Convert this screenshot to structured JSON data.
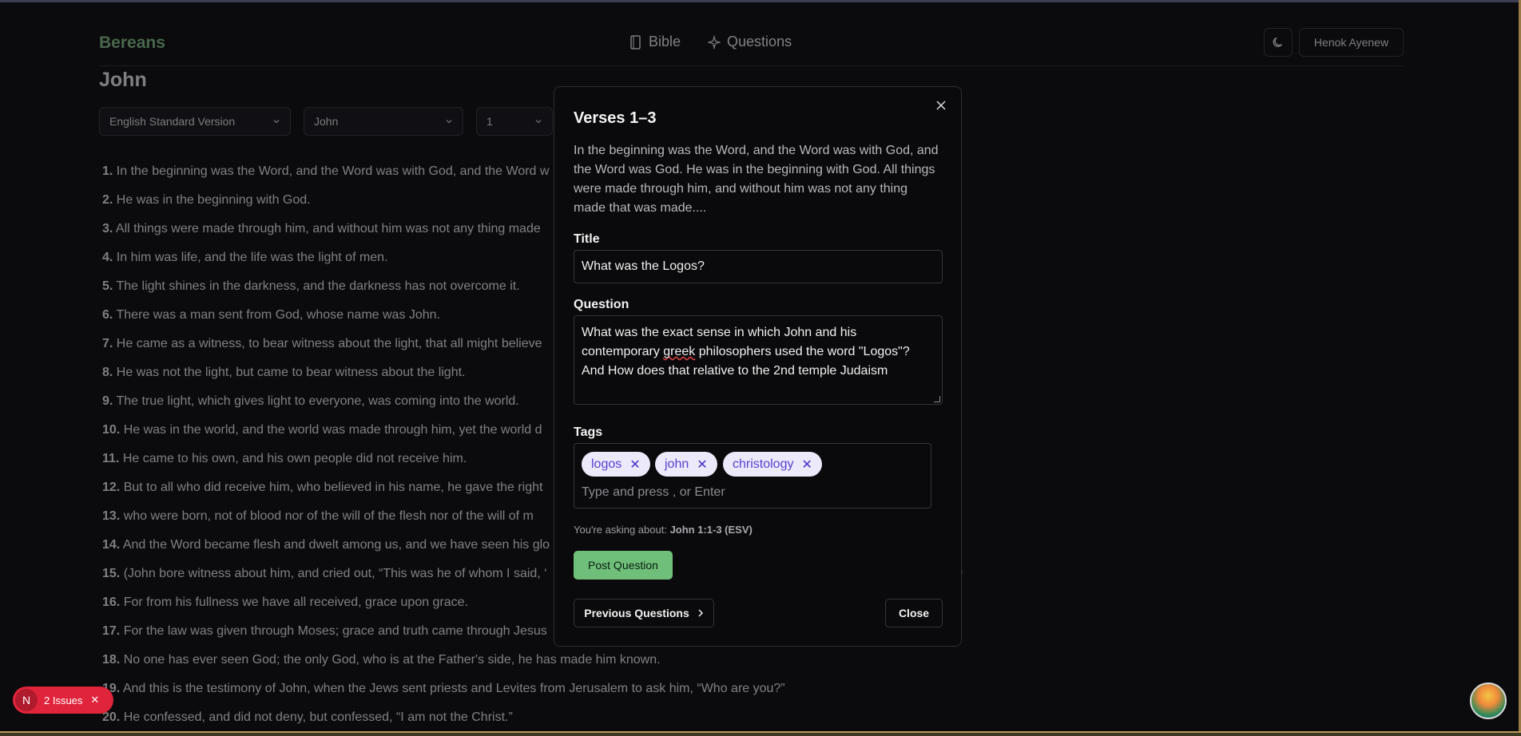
{
  "header": {
    "brand": "Bereans",
    "nav": [
      {
        "label": "Bible",
        "icon": "book-icon"
      },
      {
        "label": "Questions",
        "icon": "sparkle-icon"
      }
    ],
    "theme_icon": "moon-icon",
    "user_name": "Henok Ayenew"
  },
  "page": {
    "title": "John",
    "selects": {
      "version": "English Standard Version",
      "book": "John",
      "chapter": "1"
    },
    "verses": [
      {
        "num": "1.",
        "text": "In the beginning was the Word, and the Word was with God, and the Word w"
      },
      {
        "num": "2.",
        "text": "He was in the beginning with God."
      },
      {
        "num": "3.",
        "text": "All things were made through him, and without him was not any thing made"
      },
      {
        "num": "4.",
        "text": "In him was life, and the life was the light of men."
      },
      {
        "num": "5.",
        "text": "The light shines in the darkness, and the darkness has not overcome it."
      },
      {
        "num": "6.",
        "text": "There was a man sent from God, whose name was John."
      },
      {
        "num": "7.",
        "text": "He came as a witness, to bear witness about the light, that all might believe"
      },
      {
        "num": "8.",
        "text": "He was not the light, but came to bear witness about the light."
      },
      {
        "num": "9.",
        "text": "The true light, which gives light to everyone, was coming into the world."
      },
      {
        "num": "10.",
        "text": "He was in the world, and the world was made through him, yet the world d"
      },
      {
        "num": "11.",
        "text": "He came to his own, and his own people did not receive him."
      },
      {
        "num": "12.",
        "text": "But to all who did receive him, who believed in his name, he gave the right"
      },
      {
        "num": "13.",
        "text": "who were born, not of blood nor of the will of the flesh nor of the will of m"
      },
      {
        "num": "14.",
        "text": "And the Word became flesh and dwelt among us, and we have seen his glo"
      },
      {
        "num": "15.",
        "text": "(John bore witness about him, and cried out, “This was he of whom I said, ‘"
      },
      {
        "num": "16.",
        "text": "For from his fullness we have all received, grace upon grace."
      },
      {
        "num": "17.",
        "text": "For the law was given through Moses; grace and truth came through Jesus"
      },
      {
        "num": "18.",
        "text": "No one has ever seen God; the only God, who is at the Father's side, he has made him known."
      },
      {
        "num": "19.",
        "text": "And this is the testimony of John, when the Jews sent priests and Levites from Jerusalem to ask him, “Who are you?”"
      },
      {
        "num": "20.",
        "text": "He confessed, and did not deny, but confessed, “I am not the Christ.”"
      }
    ],
    "verse15_tail": ")"
  },
  "modal": {
    "title": "Verses 1–3",
    "passage": "In the beginning was the Word, and the Word was with God, and the Word was God. He was in the beginning with God. All things were made through him, and without him was not any thing made that was made....",
    "title_label": "Title",
    "title_value": "What was the Logos?",
    "question_label": "Question",
    "question_parts": {
      "before": "What was the exact sense in which John and his contemporary ",
      "misspelled": "greek",
      "after": " philosophers used the word \"Logos\"? And How does that relative to the 2nd temple Judaism"
    },
    "tags_label": "Tags",
    "tags": [
      "logos",
      "john",
      "christology"
    ],
    "tags_placeholder": "Type and press , or Enter",
    "asking_prefix": "You're asking about:",
    "asking_ref": "John 1:1-3 (ESV)",
    "post_label": "Post Question",
    "previous_label": "Previous Questions",
    "close_label": "Close"
  },
  "overlay": {
    "issues_letter": "N",
    "issues_label": "2 Issues"
  },
  "colors": {
    "brand": "#86c48c",
    "accent_button": "#6fbf7a",
    "tag_bg": "#ece9fb",
    "tag_text": "#5a3fd0",
    "issues_bg": "#e0243b"
  }
}
